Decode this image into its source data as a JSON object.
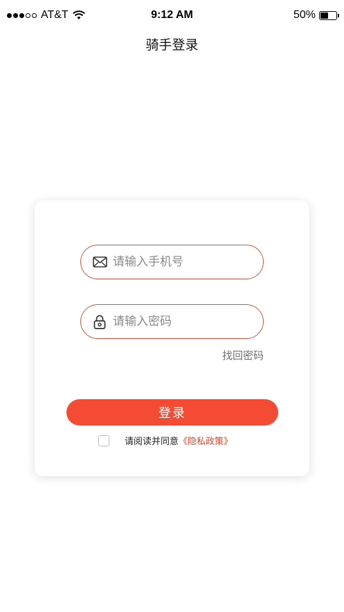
{
  "status_bar": {
    "carrier": "AT&T",
    "time": "9:12 AM",
    "battery_text": "50%",
    "battery_level": 0.5,
    "signal_bars_filled": 3,
    "signal_bars_total": 5
  },
  "header": {
    "title": "骑手登录"
  },
  "form": {
    "phone_placeholder": "请输入手机号",
    "phone_icon": "envelope-icon",
    "password_placeholder": "请输入密码",
    "password_icon": "lock-icon",
    "forgot_label": "找回密码",
    "login_label": "登录",
    "agree_text": "请阅读并同意",
    "policy_link": "《隐私政策》"
  },
  "colors": {
    "accent": "#f44b35",
    "field_border": "#c9573f",
    "link": "#e2442f"
  }
}
